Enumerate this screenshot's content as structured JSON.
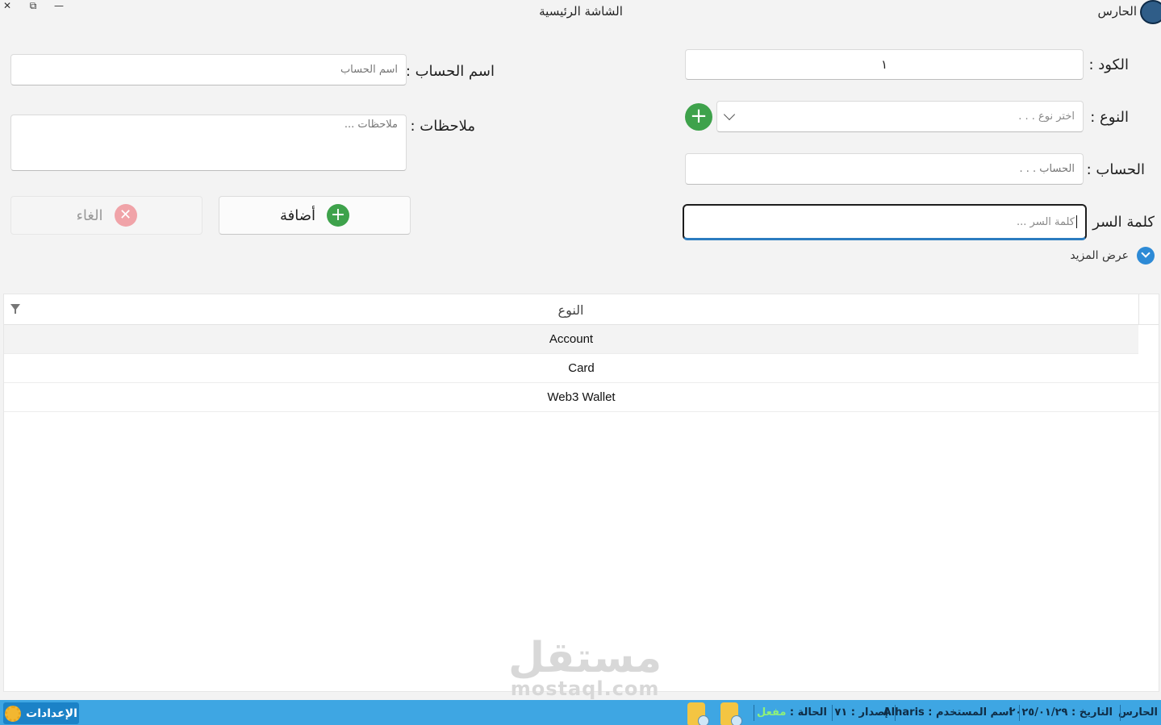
{
  "window": {
    "title": "الشاشة الرئيسية",
    "app_name": "الحارس",
    "restore_glyph": "⧉",
    "minimize_glyph": "—",
    "close_glyph": "✕"
  },
  "form": {
    "code": {
      "label": "الكود :",
      "value": "١"
    },
    "type": {
      "label": "النوع :",
      "placeholder": "اختر نوع . . ."
    },
    "account": {
      "label": "الحساب :",
      "placeholder": "الحساب . . ."
    },
    "password": {
      "label": "كلمة السر :",
      "placeholder": "كلمة السر ..."
    },
    "account_name": {
      "label": "اسم الحساب :",
      "placeholder": "اسم الحساب"
    },
    "notes": {
      "label": "ملاحظات :",
      "placeholder": "ملاحظات ..."
    },
    "show_more": "عرض المزيد",
    "add_type_glyph": "+"
  },
  "buttons": {
    "add": {
      "label": "أضافة",
      "glyph": "+"
    },
    "cancel": {
      "label": "الغاء",
      "glyph": "✕"
    }
  },
  "table": {
    "column": "النوع",
    "rows": [
      "Account",
      "Card",
      "Web3 Wallet"
    ]
  },
  "watermark": {
    "arabic": "مستقل",
    "latin": "mostaql.com"
  },
  "status_bar": {
    "app": "الحارس",
    "date": "التاريخ : ٢٠٢٥/٠١/٢٩",
    "username": "اسم المستخدم : Alharis",
    "version": "إصدار : ٧١",
    "state_label": "الحالة :",
    "state_value": "مفعل",
    "settings": "الإعدادات"
  },
  "colors": {
    "status_bar": "#3ea6e3",
    "accent_green": "#3ea24b",
    "accent_blue": "#2d8ad6",
    "cancel_red": "#f0a3a8"
  },
  "icons": {
    "logo": "shield-logo-icon",
    "add_type": "plus-circle-icon",
    "dropdown": "chevron-down-icon",
    "show_more": "chevron-down-circle-icon",
    "filter": "filter-icon",
    "backup": "database-backup-icon",
    "restore": "database-restore-icon",
    "settings": "gear-icon"
  }
}
